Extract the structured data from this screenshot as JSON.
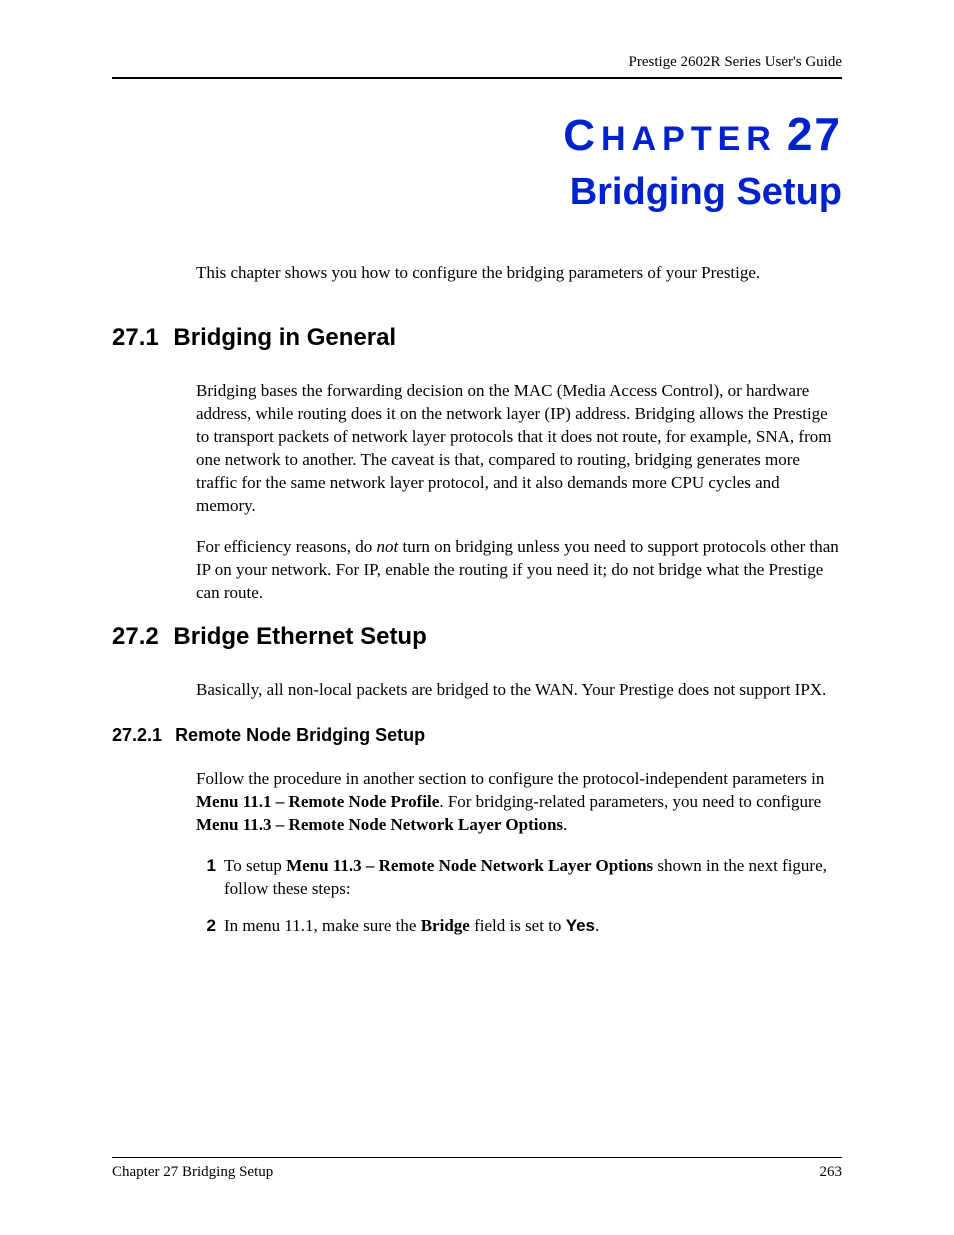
{
  "header": {
    "guide_title": "Prestige 2602R Series User's Guide"
  },
  "chapter": {
    "word_first_letter": "C",
    "word_rest": "HAPTER",
    "number": "27",
    "title": "Bridging Setup"
  },
  "intro": "This chapter shows you how to configure the bridging parameters of your Prestige.",
  "sections": {
    "s1": {
      "num": "27.1",
      "title": "Bridging in General",
      "p1": "Bridging bases the forwarding decision on the MAC (Media Access Control), or hardware address, while routing does it on the network layer (IP) address. Bridging allows the Prestige to transport packets of network layer protocols that it does not route, for example, SNA, from one network to another. The caveat is that, compared to routing, bridging generates more traffic for the same network layer protocol, and it also demands more CPU cycles and memory.",
      "p2_a": "For efficiency reasons, do ",
      "p2_i": "not",
      "p2_b": " turn on bridging unless you need to support protocols other than IP on your network. For IP, enable the routing if you need it; do not bridge what the Prestige can route."
    },
    "s2": {
      "num": "27.2",
      "title": "Bridge Ethernet Setup",
      "p1": "Basically, all non-local packets are bridged to the WAN. Your Prestige does not support IPX."
    },
    "s21": {
      "num": "27.2.1",
      "title": "Remote Node Bridging Setup",
      "p1_a": "Follow the procedure in another section to configure the protocol-independent parameters in ",
      "p1_b1": "Menu 11.1 – Remote Node Profile",
      "p1_c": ". For bridging-related parameters, you need to configure ",
      "p1_b2": "Menu 11.3 – Remote Node Network Layer Options",
      "p1_d": ".",
      "list": {
        "i1": {
          "num": "1",
          "a": "To setup ",
          "b": "Menu 11.3 – Remote Node Network Layer Options",
          "c": " shown in the next figure, follow these steps:"
        },
        "i2": {
          "num": "2",
          "a": "In menu 11.1, make sure the ",
          "b": "Bridge",
          "c": " field is set to ",
          "d": "Yes",
          "e": "."
        }
      }
    }
  },
  "footer": {
    "left": "Chapter 27 Bridging Setup",
    "right": "263"
  }
}
